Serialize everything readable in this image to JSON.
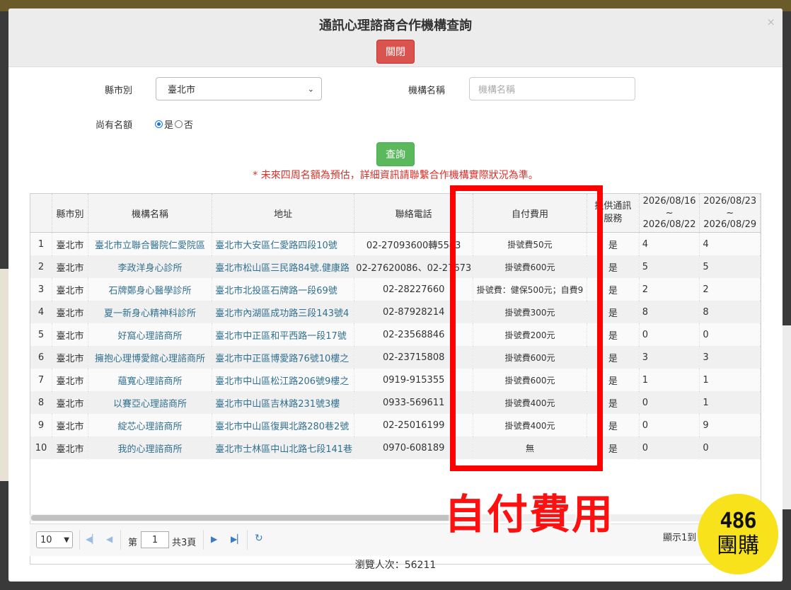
{
  "dialog": {
    "title": "通訊心理諮商合作機構查詢",
    "close_x": "×",
    "close_button": "關閉"
  },
  "form": {
    "city_label": "縣市別",
    "city_value": "臺北市",
    "org_label": "機構名稱",
    "org_placeholder": "機構名稱",
    "quota_label": "尚有名額",
    "radio_yes": "是",
    "radio_no": "否",
    "radio_selected": "是",
    "query_button": "查詢"
  },
  "notice": "* 未來四周名額為預估，詳細資訊請聯繫合作機構實際狀況為準。",
  "table": {
    "headers": {
      "city": "縣市別",
      "name": "機構名稱",
      "address": "地址",
      "phone": "聯絡電話",
      "fee": "自付費用",
      "service": "提供通訊服務",
      "week1_start": "2026/08/16",
      "week1_tilde": "~",
      "week1_end": "2026/08/22",
      "week2_start": "2026/08/23",
      "week2_tilde": "~",
      "week2_end": "2026/08/29"
    },
    "rows": [
      {
        "no": "1",
        "city": "臺北市",
        "name": "臺北市立聯合醫院仁愛院區",
        "address": "臺北市大安區仁愛路四段10號",
        "phone": "02-27093600轉5543",
        "fee": "掛號費50元",
        "service": "是",
        "w1": "4",
        "w2": "4"
      },
      {
        "no": "2",
        "city": "臺北市",
        "name": "李政洋身心診所",
        "address": "臺北市松山區三民路84號.健康路",
        "phone": "02-27620086、02-27673",
        "fee": "掛號費600元",
        "service": "是",
        "w1": "5",
        "w2": "5"
      },
      {
        "no": "3",
        "city": "臺北市",
        "name": "石牌鄭身心醫學診所",
        "address": "臺北市北投區石牌路一段69號",
        "phone": "02-28227660",
        "fee": "掛號費：健保500元；自費9",
        "service": "是",
        "w1": "2",
        "w2": "2"
      },
      {
        "no": "4",
        "city": "臺北市",
        "name": "夏一新身心精神科診所",
        "address": "臺北市內湖區成功路三段143號4",
        "phone": "02-87928214",
        "fee": "掛號費300元",
        "service": "是",
        "w1": "8",
        "w2": "8"
      },
      {
        "no": "5",
        "city": "臺北市",
        "name": "好窩心理諮商所",
        "address": "臺北市中正區和平西路一段17號",
        "phone": "02-23568846",
        "fee": "掛號費200元",
        "service": "是",
        "w1": "0",
        "w2": "0"
      },
      {
        "no": "6",
        "city": "臺北市",
        "name": "擁抱心理博愛館心理諮商所",
        "address": "臺北市中正區博愛路76號10樓之",
        "phone": "02-23715808",
        "fee": "掛號費600元",
        "service": "是",
        "w1": "3",
        "w2": "3"
      },
      {
        "no": "7",
        "city": "臺北市",
        "name": "蘊寬心理諮商所",
        "address": "臺北市中山區松江路206號9樓之",
        "phone": "0919-915355",
        "fee": "掛號費600元",
        "service": "是",
        "w1": "1",
        "w2": "1"
      },
      {
        "no": "8",
        "city": "臺北市",
        "name": "以賽亞心理諮商所",
        "address": "臺北市中山區吉林路231號3樓",
        "phone": "0933-569611",
        "fee": "掛號費400元",
        "service": "是",
        "w1": "0",
        "w2": "1"
      },
      {
        "no": "9",
        "city": "臺北市",
        "name": "綻芯心理諮商所",
        "address": "臺北市中山區復興北路280巷2號",
        "phone": "02-25016199",
        "fee": "掛號費400元",
        "service": "是",
        "w1": "0",
        "w2": "9"
      },
      {
        "no": "10",
        "city": "臺北市",
        "name": "我的心理諮商所",
        "address": "臺北市士林區中山北路七段141巷",
        "phone": "0970-608189",
        "fee": "無",
        "service": "是",
        "w1": "0",
        "w2": "0"
      }
    ]
  },
  "pager": {
    "page_size": "10",
    "page_prefix": "第",
    "page_value": "1",
    "page_suffix": "共3頁",
    "info": "顯示1到"
  },
  "visits": "瀏覽人次：56211",
  "annotation": {
    "label": "自付費用",
    "color": "#ff0000"
  },
  "logo": {
    "number": "486",
    "text": "團購",
    "color": "#f7e21b"
  },
  "icons": [
    "close-icon",
    "first-page-icon",
    "prev-page-icon",
    "next-page-icon",
    "last-page-icon",
    "refresh-icon",
    "chevron-down-icon"
  ]
}
